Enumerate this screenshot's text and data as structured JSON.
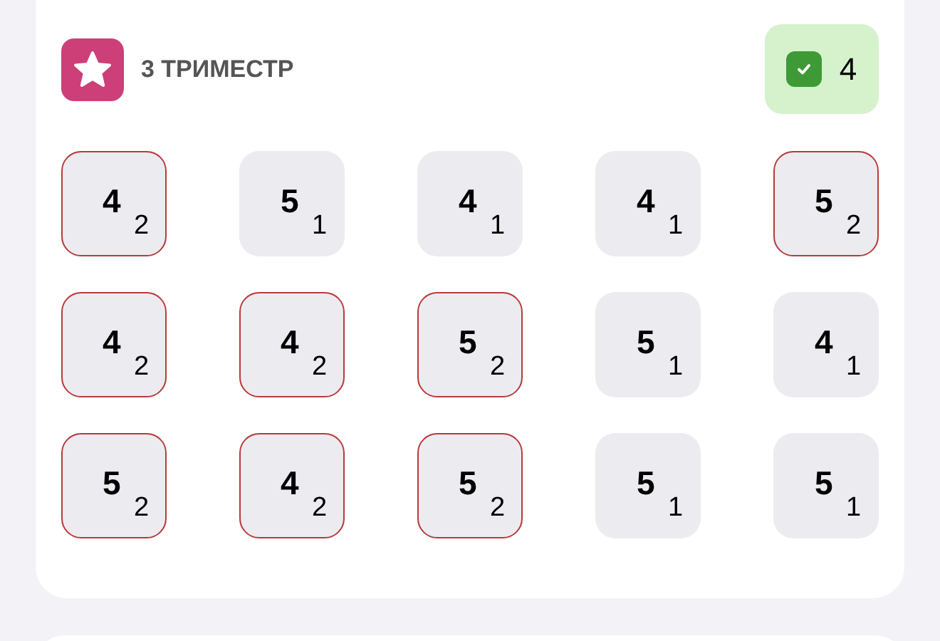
{
  "header": {
    "title": "3 ТРИМЕСТР",
    "badge": {
      "checked": true,
      "value": "4"
    }
  },
  "grades": [
    {
      "value": "4",
      "weight": "2",
      "highlighted": true
    },
    {
      "value": "5",
      "weight": "1",
      "highlighted": false
    },
    {
      "value": "4",
      "weight": "1",
      "highlighted": false
    },
    {
      "value": "4",
      "weight": "1",
      "highlighted": false
    },
    {
      "value": "5",
      "weight": "2",
      "highlighted": true
    },
    {
      "value": "4",
      "weight": "2",
      "highlighted": true
    },
    {
      "value": "4",
      "weight": "2",
      "highlighted": true
    },
    {
      "value": "5",
      "weight": "2",
      "highlighted": true
    },
    {
      "value": "5",
      "weight": "1",
      "highlighted": false
    },
    {
      "value": "4",
      "weight": "1",
      "highlighted": false
    },
    {
      "value": "5",
      "weight": "2",
      "highlighted": true
    },
    {
      "value": "4",
      "weight": "2",
      "highlighted": true
    },
    {
      "value": "5",
      "weight": "2",
      "highlighted": true
    },
    {
      "value": "5",
      "weight": "1",
      "highlighted": false
    },
    {
      "value": "5",
      "weight": "1",
      "highlighted": false
    }
  ]
}
